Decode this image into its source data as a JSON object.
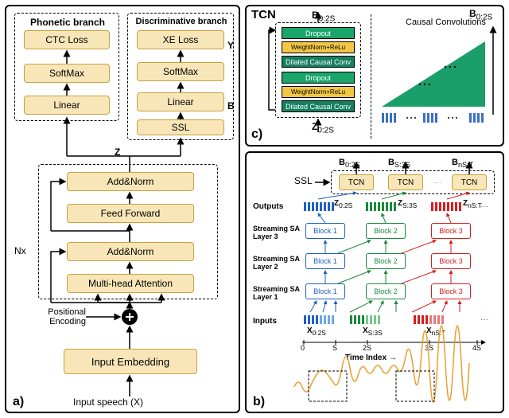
{
  "panelA": {
    "tag": "a)",
    "branches": {
      "phonetic": "Phonetic branch",
      "discriminative": "Discriminative branch"
    },
    "blocks": {
      "ctc": "CTC Loss",
      "xe": "XE Loss",
      "softmax1": "SoftMax",
      "softmax2": "SoftMax",
      "linear1": "Linear",
      "linear2": "Linear",
      "ssl": "SSL",
      "addnorm1": "Add&Norm",
      "addnorm2": "Add&Norm",
      "ff": "Feed Forward",
      "mha": "Multi-head Attention",
      "embed": "Input Embedding"
    },
    "labels": {
      "Z": "Z",
      "Y": "Y",
      "B": "B",
      "Nx": "Nx",
      "posenc": "Positional\nEncoding",
      "input": "Input speech (X)"
    }
  },
  "panelC": {
    "tag": "c)",
    "title": "TCN",
    "layers": {
      "dropout": "Dropout",
      "wnrelu": "WeightNorm+ReLu",
      "dcc": "Dilated Causal Conv"
    },
    "io": {
      "in": "Z",
      "out": "B",
      "sub": "0:2S"
    },
    "caption": "Causal Convolutions",
    "bout": "B",
    "bout_sub": "0:2S"
  },
  "panelB": {
    "tag": "b)",
    "ssl": "SSL",
    "tcn": "TCN",
    "outs": {
      "B0": "B",
      "B1": "B",
      "B2": "B",
      "sub0": "0:2S",
      "sub1": "S:3S",
      "sub2": "nS:T"
    },
    "rowlabels": {
      "outputs": "Outputs",
      "l3": "Streaming SA\nLayer 3",
      "l2": "Streaming SA\nLayer 2",
      "l1": "Streaming SA\nLayer 1",
      "inputs": "Inputs"
    },
    "blocks": {
      "b1": "Block 1",
      "b2": "Block 2",
      "b3": "Block 3"
    },
    "zlabels": {
      "z0": "Z",
      "z1": "Z",
      "z2": "Z",
      "sub0": "0:2S",
      "sub1": "S:3S",
      "sub2": "nS:T"
    },
    "xlabels": {
      "x0": "X",
      "x1": "X",
      "x2": "X",
      "sub0": "0:2S",
      "sub1": "S:3S",
      "sub2": "nS:T"
    },
    "axis": {
      "ticks": [
        "0",
        "S",
        "2S",
        "3S",
        "4S"
      ],
      "label": "Time Index"
    }
  }
}
